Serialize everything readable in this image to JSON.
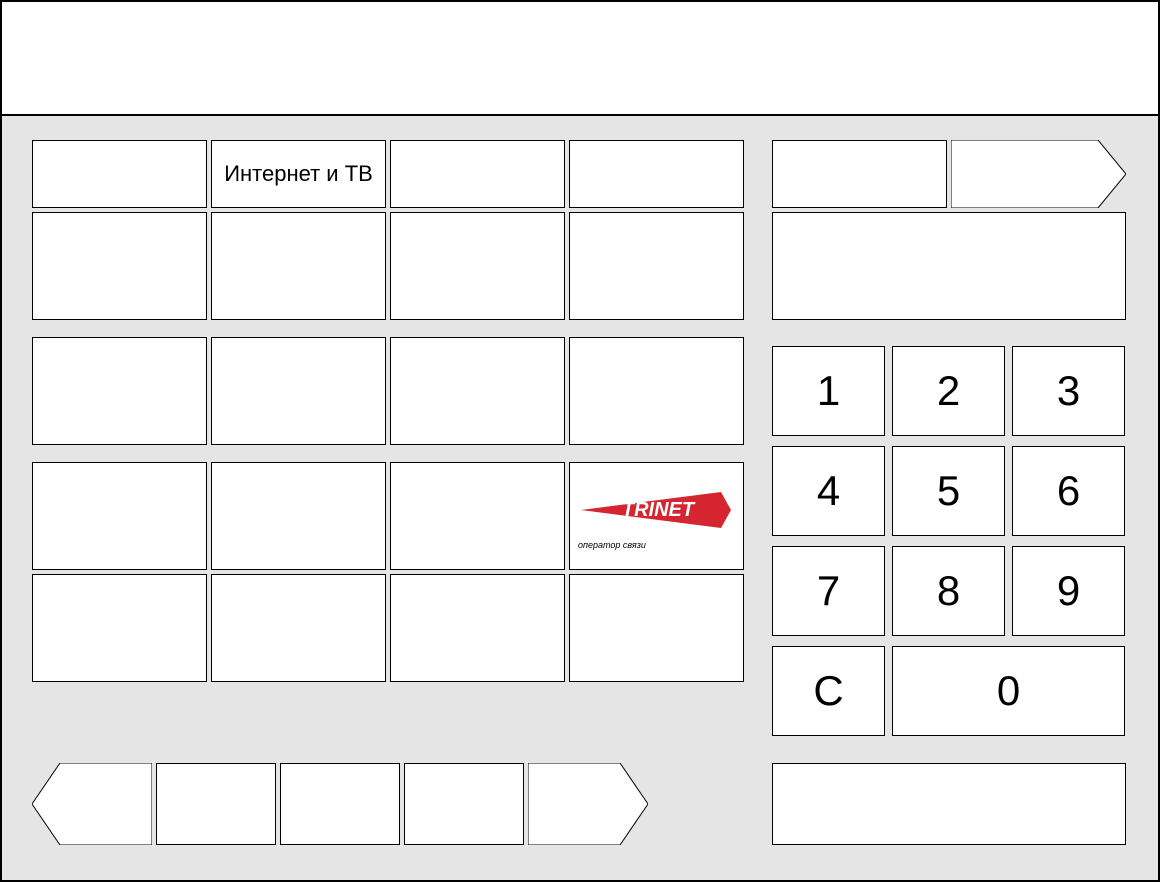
{
  "categories": {
    "row1": [
      "",
      "Интернет и ТВ",
      "",
      "",
      ""
    ],
    "row2": [
      "",
      "",
      "",
      ""
    ]
  },
  "logo": {
    "brand": "TRINET",
    "tagline": "оператор связи"
  },
  "keypad": {
    "k1": "1",
    "k2": "2",
    "k3": "3",
    "k4": "4",
    "k5": "5",
    "k6": "6",
    "k7": "7",
    "k8": "8",
    "k9": "9",
    "kc": "C",
    "k0": "0"
  }
}
